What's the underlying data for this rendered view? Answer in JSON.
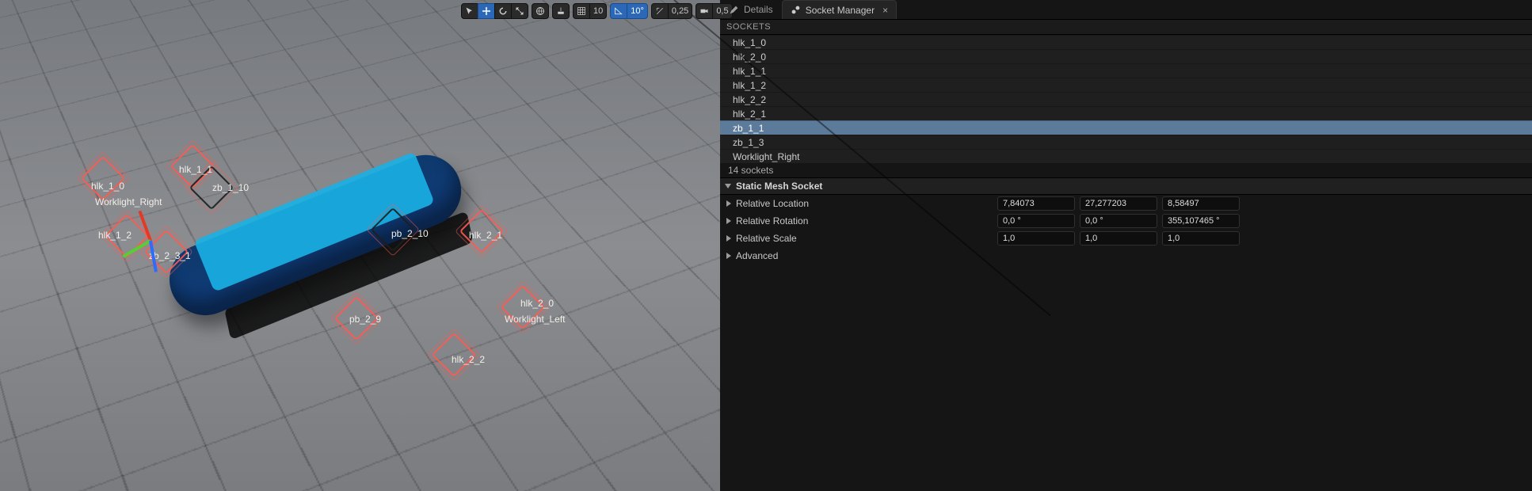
{
  "toolbar": {
    "grid_value": "10",
    "angle_value": "10°",
    "scale_value": "0,25",
    "camera_value": "0,5"
  },
  "tabs": {
    "details_label": "Details",
    "socket_manager_label": "Socket Manager"
  },
  "sockets": {
    "section_label": "SOCKETS",
    "items": [
      {
        "name": "hlk_1_0",
        "selected": false
      },
      {
        "name": "hlk_2_0",
        "selected": false
      },
      {
        "name": "hlk_1_1",
        "selected": false
      },
      {
        "name": "hlk_1_2",
        "selected": false
      },
      {
        "name": "hlk_2_2",
        "selected": false
      },
      {
        "name": "hlk_2_1",
        "selected": false
      },
      {
        "name": "zb_1_1",
        "selected": true
      },
      {
        "name": "zb_1_3",
        "selected": false
      },
      {
        "name": "Worklight_Right",
        "selected": false
      }
    ],
    "summary": "14 sockets"
  },
  "category": {
    "label": "Static Mesh Socket"
  },
  "props": {
    "location": {
      "label": "Relative Location",
      "x": "7,84073",
      "y": "27,277203",
      "z": "8,58497"
    },
    "rotation": {
      "label": "Relative Rotation",
      "x": "0,0 °",
      "y": "0,0 °",
      "z": "355,107465 °"
    },
    "scale": {
      "label": "Relative Scale",
      "x": "1,0",
      "y": "1,0",
      "z": "1,0"
    },
    "advanced_label": "Advanced"
  },
  "viewport_labels": {
    "hlk_1_0": "hlk_1_0",
    "worklight_right": "Worklight_Right",
    "hlk_1_1": "hlk_1_1",
    "zb_1_10": "zb_1_10",
    "hlk_1_2": "hlk_1_2",
    "pb_2_10": "pb_2_10",
    "hlk_2_1": "hlk_2_1",
    "zb_2_3_1": "zb_2_3_1",
    "hlk_2_0": "hlk_2_0",
    "worklight_left": "Worklight_Left",
    "pb_2_9": "pb_2_9",
    "hlk_2_2": "hlk_2_2"
  }
}
